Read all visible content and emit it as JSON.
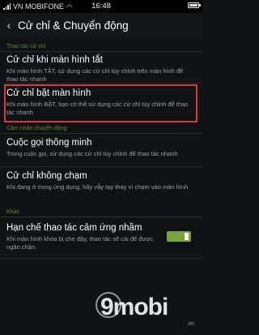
{
  "status_bar": {
    "carrier": "VN MOBIFONE",
    "time": "16:48",
    "battery_level": 0.8
  },
  "header": {
    "back_icon": "chevron-left-icon",
    "title": "Cử chỉ & Chuyển động"
  },
  "sections": {
    "gesture_section_header": "Thao tác cử chỉ",
    "motion_section_header": "Cảm nhận chuyển động",
    "other_section_header": "Khác"
  },
  "items": {
    "screen_off": {
      "title": "Cử chỉ khi màn hình tắt",
      "desc": "Khi màn hình TẮT, sử dụng các cử chỉ tùy chỉnh trên màn hình để thao tác nhanh"
    },
    "screen_on": {
      "title": "Cử chỉ bật màn hình",
      "desc": "Khi màn hình BẬT, bạn có thể sử dụng các cử chỉ tùy chỉnh để thao tác nhanh"
    },
    "smart_call": {
      "title": "Cuộc gọi thông minh",
      "desc": "Trong cuộc gọi, sử dụng các cử chỉ tùy chỉnh để thao tác nhanh"
    },
    "no_touch": {
      "title": "Cử chỉ không chạm",
      "desc": "Khi đang ở trong ứng dụng, hãy vẫy tay thay vì chạm vào màn hình"
    },
    "prevent_misoperation": {
      "title": "Hạn chế thao tác cảm ứng nhầm",
      "desc": "Khi màn hình khóa bị che đậy, thao tác sẽ cài để được ngăn chặn.",
      "enabled": true
    }
  },
  "watermark": {
    "logo": "9mobi",
    "domain": ".vn"
  },
  "colors": {
    "accent_green": "#7aa43a",
    "highlight_red": "#d83a3f",
    "background": "#111214"
  }
}
